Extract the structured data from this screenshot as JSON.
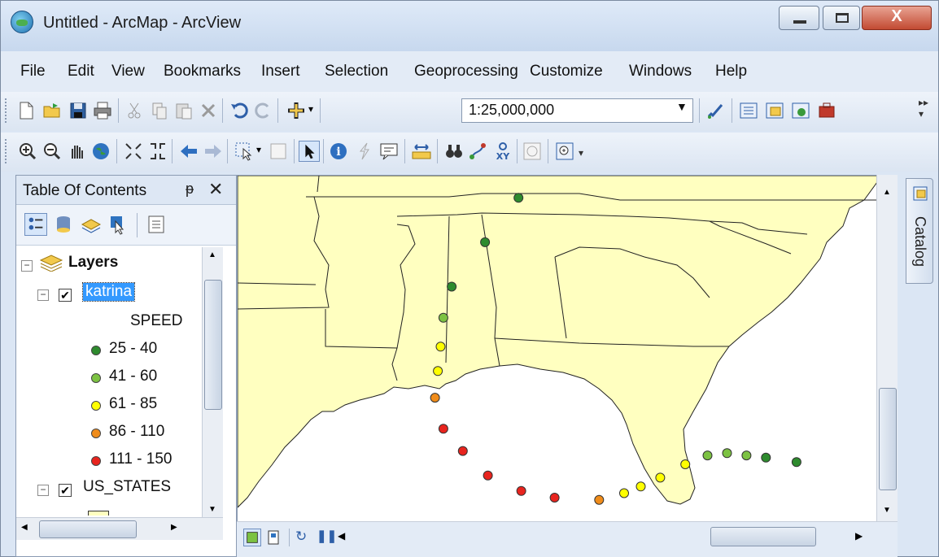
{
  "window": {
    "title": "Untitled - ArcMap - ArcView"
  },
  "menu": [
    "File",
    "Edit",
    "View",
    "Bookmarks",
    "Insert",
    "Selection",
    "Geoprocessing",
    "Customize",
    "Windows",
    "Help"
  ],
  "toolbar": {
    "scale": "1:25,000,000"
  },
  "toc": {
    "title": "Table Of Contents",
    "pin": "Ѩ",
    "close": "✕",
    "layers_label": "Layers",
    "layer1": {
      "name": "katrina",
      "field": "SPEED"
    },
    "legend": [
      {
        "label": "25 - 40",
        "color": "#2e8b2e"
      },
      {
        "label": "41 - 60",
        "color": "#7cc242"
      },
      {
        "label": "61 - 85",
        "color": "#ffff00"
      },
      {
        "label": "86 - 110",
        "color": "#f08c1a"
      },
      {
        "label": "111 - 150",
        "color": "#e8241e"
      }
    ],
    "layer2": {
      "name": "US_STATES",
      "fill": "#ffffc0"
    }
  },
  "catalog": {
    "label": "Catalog"
  },
  "map": {
    "land_color": "#ffffc0",
    "water_color": "#ffffff",
    "track": [
      {
        "speed": 30,
        "lat": 37.6,
        "lon": -86.9
      },
      {
        "speed": 30,
        "lat": 35.6,
        "lon": -88.1
      },
      {
        "speed": 35,
        "lat": 33.6,
        "lon": -89.3
      },
      {
        "speed": 50,
        "lat": 32.2,
        "lon": -89.6
      },
      {
        "speed": 65,
        "lat": 30.9,
        "lon": -89.7
      },
      {
        "speed": 75,
        "lat": 29.8,
        "lon": -89.8
      },
      {
        "speed": 95,
        "lat": 28.6,
        "lon": -89.9
      },
      {
        "speed": 120,
        "lat": 27.2,
        "lon": -89.6
      },
      {
        "speed": 135,
        "lat": 26.2,
        "lon": -88.9
      },
      {
        "speed": 145,
        "lat": 25.1,
        "lon": -88.0
      },
      {
        "speed": 140,
        "lat": 24.4,
        "lon": -86.8
      },
      {
        "speed": 125,
        "lat": 24.1,
        "lon": -85.6
      },
      {
        "speed": 105,
        "lat": 24.0,
        "lon": -84.0
      },
      {
        "speed": 80,
        "lat": 24.3,
        "lon": -83.1
      },
      {
        "speed": 70,
        "lat": 24.6,
        "lon": -82.5
      },
      {
        "speed": 65,
        "lat": 25.0,
        "lon": -81.8
      },
      {
        "speed": 70,
        "lat": 25.6,
        "lon": -80.9
      },
      {
        "speed": 55,
        "lat": 26.0,
        "lon": -80.1
      },
      {
        "speed": 50,
        "lat": 26.1,
        "lon": -79.4
      },
      {
        "speed": 45,
        "lat": 26.0,
        "lon": -78.7
      },
      {
        "speed": 40,
        "lat": 25.9,
        "lon": -78.0
      },
      {
        "speed": 35,
        "lat": 25.7,
        "lon": -76.9
      }
    ]
  }
}
